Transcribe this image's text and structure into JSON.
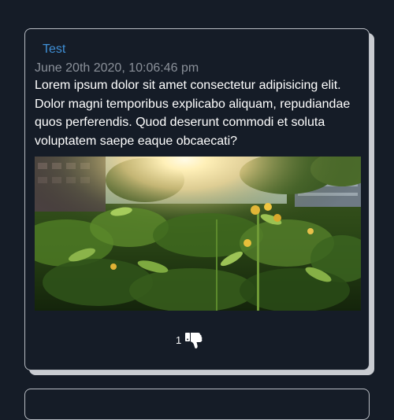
{
  "post": {
    "author": "Test",
    "timestamp": "June 20th 2020, 10:06:46 pm",
    "text": "Lorem ipsum dolor sit amet consectetur adipisicing elit. Dolor magni temporibus explicabo aliquam, repudiandae quos perferendis. Quod deserunt commodi et soluta voluptatem saepe eaque obcaecati?",
    "image_subject": "sunlit garden with green plants and yellow flowers",
    "reaction": {
      "count": "1",
      "icon": "thumbs-down-icon"
    }
  },
  "colors": {
    "background": "#151c27",
    "author_link": "#3f8fd6",
    "timestamp": "#8a9099",
    "card_border": "#b8bcc3",
    "card_shadow": "#c9ccd1"
  }
}
